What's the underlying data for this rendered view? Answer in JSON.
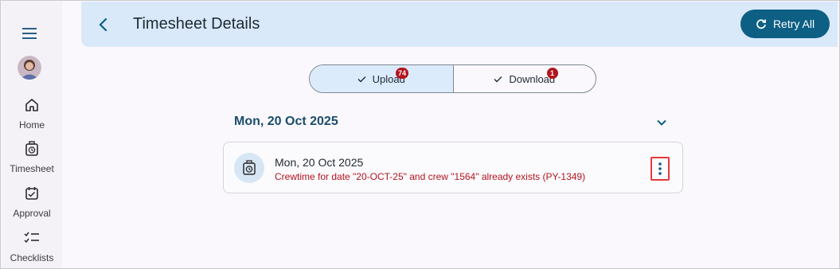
{
  "sidebar": {
    "items": [
      {
        "label": "Home",
        "icon": "home-icon"
      },
      {
        "label": "Timesheet",
        "icon": "timesheet-icon"
      },
      {
        "label": "Approval",
        "icon": "approval-icon"
      },
      {
        "label": "Checklists",
        "icon": "checklist-icon"
      }
    ]
  },
  "header": {
    "title": "Timesheet Details",
    "retry_label": "Retry All"
  },
  "tabs": [
    {
      "label": "Upload",
      "badge": "74",
      "active": true
    },
    {
      "label": "Download",
      "badge": "1",
      "active": false
    }
  ],
  "group": {
    "date": "Mon, 20 Oct 2025",
    "entries": [
      {
        "date": "Mon, 20 Oct 2025",
        "error": "Crewtime for date \"20-OCT-25\" and crew \"1564\" already exists (PY-1349)"
      }
    ]
  },
  "colors": {
    "accent": "#0d5f84",
    "header_bg": "#d9e9fa",
    "error": "#b3141d",
    "badge": "#b3141d"
  }
}
